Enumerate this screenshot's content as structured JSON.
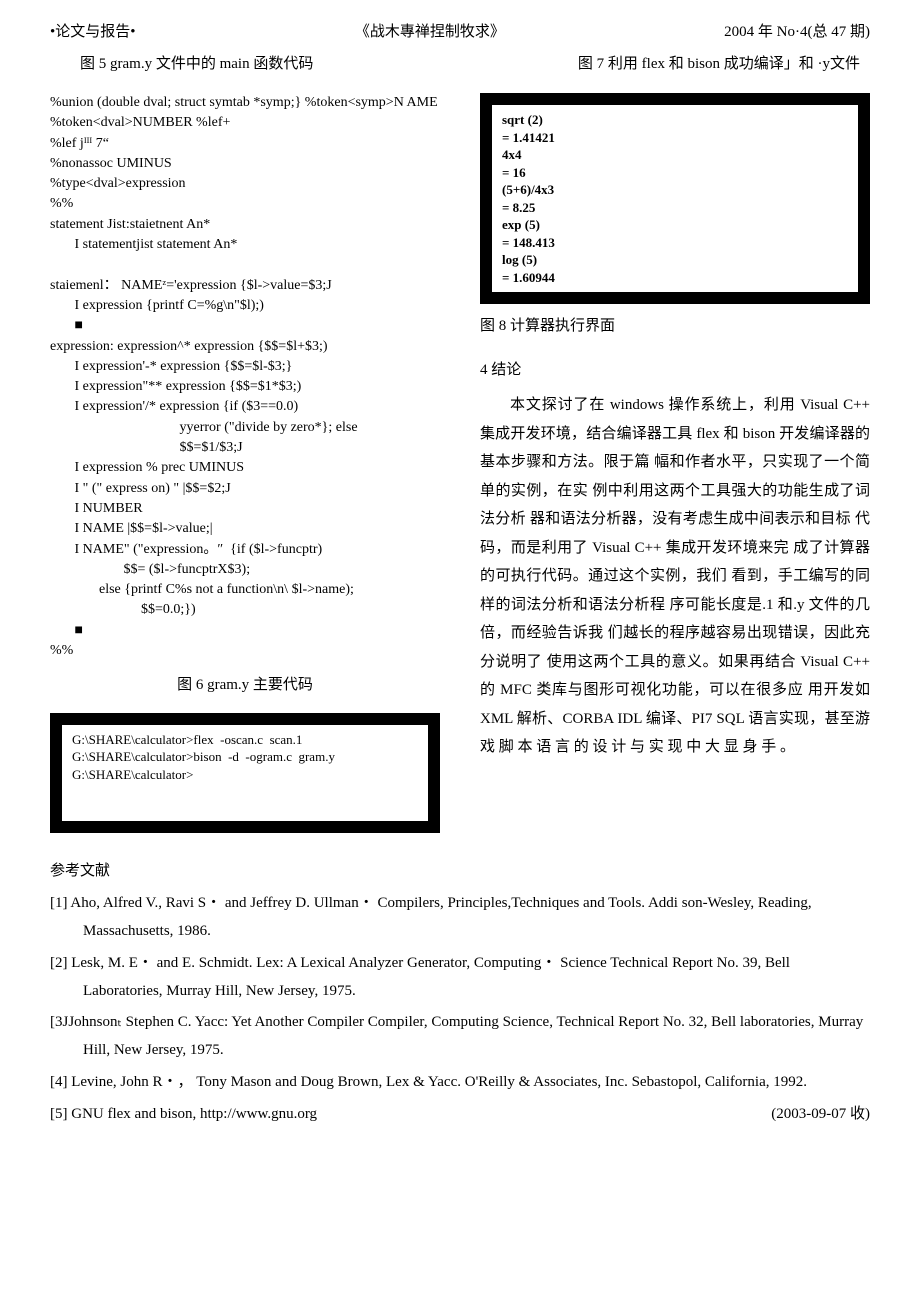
{
  "header": {
    "left": "•论文与报告•",
    "center": "《战木專禅捏制牧求》",
    "right": "2004 年 No·4(总 47 期)"
  },
  "captions": {
    "fig5": "图 5 gram.y 文件中的 main 函数代码",
    "fig6": "图 6 gram.y 主要代码",
    "fig7": "图 7 利用 flex 和 bison 成功编译」和 ·y文件",
    "fig8": "图 8 计算器执行界面"
  },
  "codeLeft": "%union (double dval; struct symtab *symp;} %token<symp>N AME\n%token<dval>NUMBER %lef+\n%lef jᴵᴵᴵ 7“\n%nonassoc UMINUS\n%type<dval>expression\n%%\nstatement Jist:staietnent An*\n       I statementjist statement An*\n\nstaiemenl： NAMEᶻ='expression {$l->value=$3;J\n       I expression {printf C=%g\\n\"$l);)\n       ■\nexpression: expression^* expression {$$=$l+$3;)\n       I expression'-* expression {$$=$l-$3;}\n       I expression\"** expression {$$=$1*$3;)\n       I expression'/* expression {if ($3==0.0)\n                                     yyerror (\"divide by zero*}; else\n                                     $$=$1/$3;J\n       I expression % prec UMINUS\n       I \" (\" express on) \" |$$=$2;J\n       I NUMBER\n       I NAME |$$=$l->value;|\n       I NAME\" (\"expression。″  {if ($l->funcptr)\n                     $$= ($l->funcptrX$3);\n              else {printf C%s not a function\\n\\ $l->name);\n                          $$=0.0;})\n       ■\n%%",
  "boxLeft": "G:\\SHARE\\calculator>flex  -oscan.c  scan.1\nG:\\SHARE\\calculator>bison  -d  -ogram.c  gram.y\nG:\\SHARE\\calculator>",
  "boxRight": "sqrt (2)\n= 1.41421\n4x4\n= 16\n(5+6)/4x3\n= 8.25\nexp (5)\n= 148.413\nlog (5)\n= 1.60944",
  "section": {
    "conclusionTitle": "4 结论",
    "conclusionBody": "本文探讨了在 windows  操作系统上，利用  Visual C++ 集成开发环境，结合编译器工具 flex 和 bison  开发编译器的基本步骤和方法。限于篇  幅和作者水平，只实现了一个简单的实例，在实  例中利用这两个工具强大的功能生成了词法分析  器和语法分析器，没有考虑生成中间表示和目标  代码，而是利用了  Visual C++ 集成开发环境来完  成了计算器的可执行代码。通过这个实例，我们  看到，手工编写的同样的词法分析和语法分析程  序可能长度是.1 和.y 文件的几倍，而经验告诉我  们越长的程序越容易出现错误，因此充分说明了  使用这两个工具的意义。如果再结合 Visual C++ 的 MFC 类库与图形可视化功能，可以在很多应  用开发如 XML 解析、CORBA IDL  编译、PI7 SQL  语言实现，甚至游戏 脚 本 语 言 的 设 计 与 实 现   中 大 显 身 手 。"
  },
  "references": {
    "title": "参考文献",
    "items": [
      "[1]  Aho, Alfred V., Ravi S・ and Jeffrey D. Ullman・ Compilers, Principles,Techniques and Tools. Addi son-Wesley, Reading, Massachusetts, 1986.",
      "[2]  Lesk, M. E・ and E. Schmidt. Lex: A Lexical Analyzer Generator, Computing・ Science Technical Report No. 39, Bell Laboratories, Murray Hill, New Jersey, 1975.",
      "[3JJohnsonₜ Stephen C. Yacc: Yet Another Compiler Compiler, Computing Science, Technical Report No. 32, Bell laboratories, Murray Hill, New Jersey, 1975.",
      "[4]  Levine, John R・， Tony Mason and Doug Brown, Lex & Yacc. O'Reilly & Associates, Inc. Sebastopol, California, 1992.",
      "[5]  GNU flex and bison, http://www.gnu.org"
    ],
    "date": "(2003-09-07 收)"
  }
}
